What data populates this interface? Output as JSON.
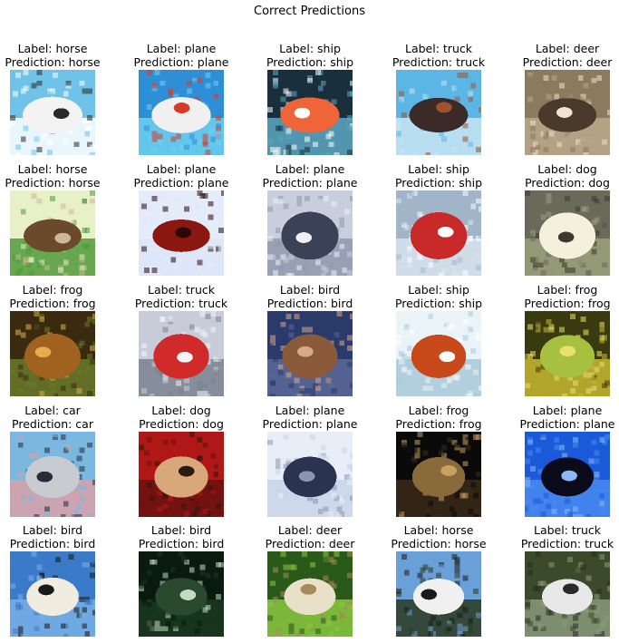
{
  "figure": {
    "title": "Correct Predictions",
    "label_prefix": "Label: ",
    "prediction_prefix": "Prediction: "
  },
  "items": [
    {
      "label": "horse",
      "prediction": "horse",
      "scene": "horse on white background with sky above",
      "colors": {
        "bg": "#6fc3e8",
        "mid": "#ffffff",
        "main": "#f3f3f3",
        "accent": "#2a2a2a"
      }
    },
    {
      "label": "plane",
      "prediction": "plane",
      "scene": "airliner front view over blue sky",
      "colors": {
        "bg": "#2f8fd6",
        "mid": "#6fd0f0",
        "main": "#f0f0f0",
        "accent": "#d83a2a"
      }
    },
    {
      "label": "ship",
      "prediction": "ship",
      "scene": "orange boat on dark water",
      "colors": {
        "bg": "#1a2f3c",
        "mid": "#5ca8c2",
        "main": "#f0643a",
        "accent": "#ffffff"
      }
    },
    {
      "label": "truck",
      "prediction": "truck",
      "scene": "dark truck under cloudy blue sky",
      "colors": {
        "bg": "#5bb6e6",
        "mid": "#c8e4f2",
        "main": "#3a2a28",
        "accent": "#a0522d"
      }
    },
    {
      "label": "deer",
      "prediction": "deer",
      "scene": "deer in brown foliage",
      "colors": {
        "bg": "#8a7a5e",
        "mid": "#b8a88a",
        "main": "#4a3a2c",
        "accent": "#ece4d0"
      }
    },
    {
      "label": "horse",
      "prediction": "horse",
      "scene": "brown horse on green grass",
      "colors": {
        "bg": "#e8f0c8",
        "mid": "#4f9a3a",
        "main": "#6a4a2a",
        "accent": "#cbb896"
      }
    },
    {
      "label": "plane",
      "prediction": "plane",
      "scene": "red biplane on pale blue",
      "colors": {
        "bg": "#e4ecfa",
        "mid": "#dce6f8",
        "main": "#8a1810",
        "accent": "#2a0a08"
      }
    },
    {
      "label": "plane",
      "prediction": "plane",
      "scene": "grey jets on light sky",
      "colors": {
        "bg": "#c8cedc",
        "mid": "#8e98ae",
        "main": "#3a4258",
        "accent": "#eef0f6"
      }
    },
    {
      "label": "ship",
      "prediction": "ship",
      "scene": "red boat in harbor",
      "colors": {
        "bg": "#a0b6c8",
        "mid": "#d8e4ee",
        "main": "#c82a2a",
        "accent": "#ffffff"
      }
    },
    {
      "label": "dog",
      "prediction": "dog",
      "scene": "white dog running on gravel",
      "colors": {
        "bg": "#6a6a5a",
        "mid": "#9aa07a",
        "main": "#f4f0dc",
        "accent": "#3a3a30"
      }
    },
    {
      "label": "frog",
      "prediction": "frog",
      "scene": "brown frog among leaves",
      "colors": {
        "bg": "#3a2a10",
        "mid": "#6a7a2a",
        "main": "#a0621e",
        "accent": "#e0b04a"
      }
    },
    {
      "label": "truck",
      "prediction": "truck",
      "scene": "red fire truck",
      "colors": {
        "bg": "#c8ccd8",
        "mid": "#7a8290",
        "main": "#d02a2a",
        "accent": "#f4f4f4"
      }
    },
    {
      "label": "bird",
      "prediction": "bird",
      "scene": "brown bird against dark blue",
      "colors": {
        "bg": "#2a3a6a",
        "mid": "#5a6a9a",
        "main": "#8a5a3a",
        "accent": "#d8a888"
      }
    },
    {
      "label": "ship",
      "prediction": "ship",
      "scene": "orange motorboat on water",
      "colors": {
        "bg": "#eaf4f8",
        "mid": "#a8c8d8",
        "main": "#c84a1a",
        "accent": "#ffffff"
      }
    },
    {
      "label": "frog",
      "prediction": "frog",
      "scene": "yellow-green frog close-up",
      "colors": {
        "bg": "#3a3a10",
        "mid": "#c8b830",
        "main": "#a8c040",
        "accent": "#e8e070"
      }
    },
    {
      "label": "car",
      "prediction": "car",
      "scene": "silver car in front of a building",
      "colors": {
        "bg": "#7ab8e0",
        "mid": "#d8a0a8",
        "main": "#c8ccd0",
        "accent": "#2a2a3a"
      }
    },
    {
      "label": "dog",
      "prediction": "dog",
      "scene": "fluffy dog face on red",
      "colors": {
        "bg": "#b01818",
        "mid": "#6a1010",
        "main": "#d8a87a",
        "accent": "#2a1a10"
      }
    },
    {
      "label": "plane",
      "prediction": "plane",
      "scene": "dark jet over white clouds",
      "colors": {
        "bg": "#e8eef8",
        "mid": "#c8d4e8",
        "main": "#2a3450",
        "accent": "#8a96b0"
      }
    },
    {
      "label": "frog",
      "prediction": "frog",
      "scene": "dark frog in shadow",
      "colors": {
        "bg": "#0a0a0a",
        "mid": "#3a2a18",
        "main": "#8a6a3a",
        "accent": "#c8a060"
      }
    },
    {
      "label": "plane",
      "prediction": "plane",
      "scene": "black jet on blue sky",
      "colors": {
        "bg": "#1a5ad8",
        "mid": "#4a8af0",
        "main": "#0a0a1a",
        "accent": "#8ab8f8"
      }
    },
    {
      "label": "bird",
      "prediction": "bird",
      "scene": "ostrich head on blue",
      "colors": {
        "bg": "#3a7ac8",
        "mid": "#7ab0e8",
        "main": "#f0ece0",
        "accent": "#1a1a1a"
      }
    },
    {
      "label": "bird",
      "prediction": "bird",
      "scene": "small bird in dark tree",
      "colors": {
        "bg": "#0a1a0e",
        "mid": "#1a3a20",
        "main": "#2a4a30",
        "accent": "#c8d8c8"
      }
    },
    {
      "label": "deer",
      "prediction": "deer",
      "scene": "white deer in green forest",
      "colors": {
        "bg": "#2a5a1a",
        "mid": "#8ac840",
        "main": "#e8e0c8",
        "accent": "#a88a5a"
      }
    },
    {
      "label": "horse",
      "prediction": "horse",
      "scene": "white horse on dark field under sky",
      "colors": {
        "bg": "#6aa0d8",
        "mid": "#2a3a20",
        "main": "#f0f0f0",
        "accent": "#1a1a1a"
      }
    },
    {
      "label": "truck",
      "prediction": "truck",
      "scene": "white truck front view",
      "colors": {
        "bg": "#3a4a2a",
        "mid": "#8a9a7a",
        "main": "#e8e8e8",
        "accent": "#2a2a2a"
      }
    }
  ]
}
